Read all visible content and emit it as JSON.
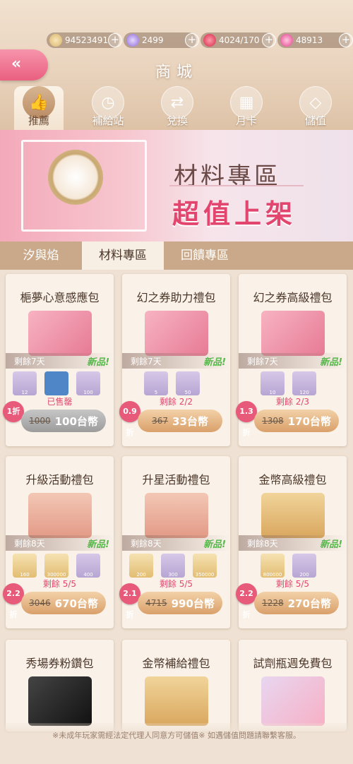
{
  "header": {
    "title": "商城",
    "resources": [
      {
        "icon": "cat-coin-icon",
        "value": "94523491"
      },
      {
        "icon": "purple-gem-icon",
        "value": "2499"
      },
      {
        "icon": "heart-icon",
        "value": "4024/170"
      },
      {
        "icon": "pink-diamond-icon",
        "value": "48913"
      }
    ]
  },
  "tabs": [
    {
      "label": "推薦",
      "icon": "thumbs-up-icon",
      "active": true
    },
    {
      "label": "補給站",
      "icon": "clock-icon"
    },
    {
      "label": "兌換",
      "icon": "exchange-icon"
    },
    {
      "label": "月卡",
      "icon": "calendar-icon"
    },
    {
      "label": "儲值",
      "icon": "diamond-icon"
    }
  ],
  "banner": {
    "line1": "材料專區",
    "line2": "超值上架"
  },
  "sub_tabs": [
    {
      "label": "汐與焰"
    },
    {
      "label": "材料專區",
      "active": true
    },
    {
      "label": "回饋專區"
    }
  ],
  "cards": [
    {
      "name": "梔夢心意感應包",
      "remaining": "剩餘7天",
      "new": "新品!",
      "status": "已售罄",
      "discount": "1折",
      "old_price": "1000",
      "price": "100台幣",
      "items": [
        "12",
        "",
        "100"
      ]
    },
    {
      "name": "幻之券助力禮包",
      "remaining": "剩餘7天",
      "new": "新品!",
      "status": "剩餘 2/2",
      "discount": "0.9折",
      "old_price": "367",
      "price": "33台幣",
      "items": [
        "5",
        "50"
      ]
    },
    {
      "name": "幻之券高級禮包",
      "remaining": "剩餘7天",
      "new": "新品!",
      "status": "剩餘 2/3",
      "discount": "1.3折",
      "old_price": "1308",
      "price": "170台幣",
      "items": [
        "10",
        "120"
      ]
    },
    {
      "name": "升級活動禮包",
      "remaining": "剩餘8天",
      "new": "新品!",
      "status": "剩餘 5/5",
      "discount": "2.2折",
      "old_price": "3046",
      "price": "670台幣",
      "items": [
        "160",
        "300000",
        "400"
      ]
    },
    {
      "name": "升星活動禮包",
      "remaining": "剩餘8天",
      "new": "新品!",
      "status": "剩餘 5/5",
      "discount": "2.1折",
      "old_price": "4715",
      "price": "990台幣",
      "items": [
        "200",
        "300",
        "350000"
      ]
    },
    {
      "name": "金幣高級禮包",
      "remaining": "剩餘8天",
      "new": "新品!",
      "status": "剩餘 5/5",
      "discount": "2.2折",
      "old_price": "1228",
      "price": "270台幣",
      "items": [
        "800000",
        "200"
      ]
    },
    {
      "name": "秀場券粉鑽包"
    },
    {
      "name": "金幣補給禮包"
    },
    {
      "name": "試劑瓶週免費包"
    }
  ],
  "footer": "※未成年玩家需經法定代理人同意方可儲值※ 如遇儲值問題請聯繫客服。"
}
